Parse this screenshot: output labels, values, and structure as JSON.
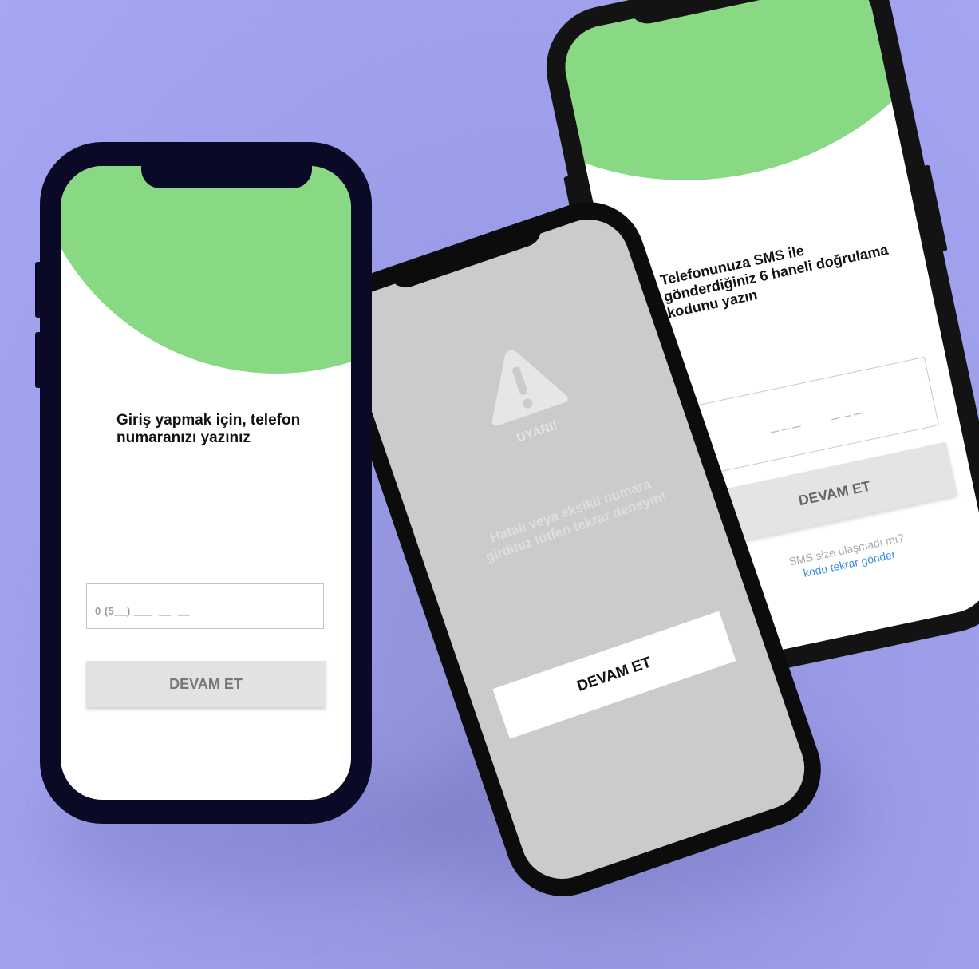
{
  "login_screen": {
    "title": "Giriş yapmak için, telefon numaranızı yazınız",
    "phone_input_value": "0 (5__) ___  __  __",
    "continue_label": "DEVAM ET"
  },
  "warning_screen": {
    "icon": "warning-triangle-icon",
    "warning_label": "UYARI!",
    "message": "Hatalı veya eksikli numara girdiniz lütfen tekrar deneyin!",
    "continue_label": "DEVAM ET"
  },
  "sms_screen": {
    "title": "Telefonunuza SMS ile gönderdiğiniz 6 haneli doğrulama kodunu yazın",
    "code_input_value": "___    ___",
    "continue_label": "DEVAM ET",
    "resend_question": "SMS size ulaşmadı mı?",
    "resend_link": "kodu tekrar gönder"
  },
  "colors": {
    "background": "#a6a6f3",
    "accent_green": "#89d884",
    "link_blue": "#3a8de0",
    "phone1_frame": "#0a0a26",
    "phone2_frame": "#0c0c0c",
    "phone3_frame": "#131313"
  }
}
